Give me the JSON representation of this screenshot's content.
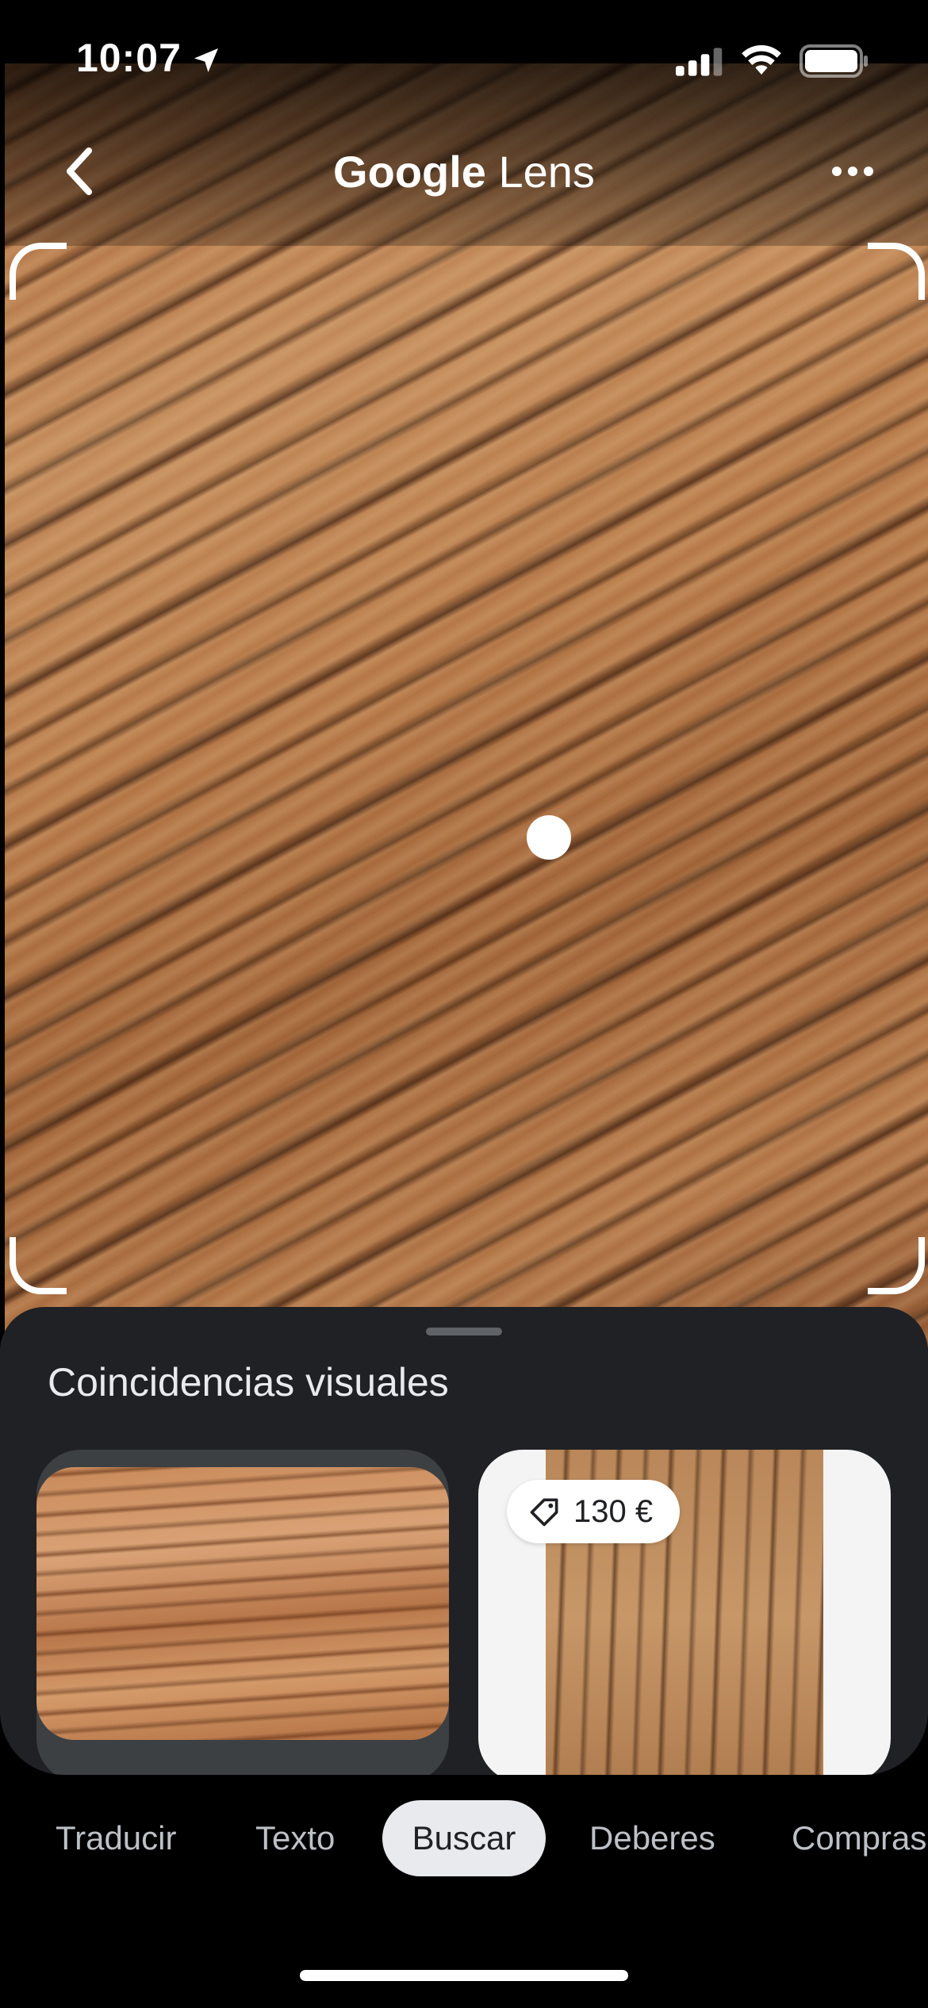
{
  "status_bar": {
    "time": "10:07",
    "location_icon": "location-arrow-icon",
    "signal_icon": "cellular-signal-icon",
    "wifi_icon": "wifi-icon",
    "battery_icon": "battery-icon"
  },
  "header": {
    "title_brand": "Google",
    "title_product": "Lens",
    "back_icon": "chevron-left-icon",
    "more_icon": "more-horizontal-icon"
  },
  "sheet": {
    "title": "Coincidencias visuales",
    "results": [
      {
        "thumbnail": "wood-grain-image"
      },
      {
        "thumbnail": "wood-board-image",
        "price": "130 €",
        "price_icon": "price-tag-icon"
      }
    ]
  },
  "modes": {
    "tabs": [
      "Traducir",
      "Texto",
      "Buscar",
      "Deberes",
      "Compras"
    ],
    "selected": "Buscar"
  },
  "colors": {
    "sheet_background": "#202124",
    "selected_tab_background": "#e8eaed",
    "tab_text": "#bdc1c6"
  }
}
